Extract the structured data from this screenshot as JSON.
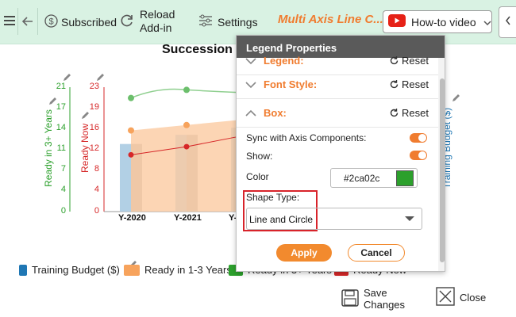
{
  "toolbar": {
    "subscribed_label": "Subscribed",
    "reload_label_1": "Reload",
    "reload_label_2": "Add-in",
    "settings_label": "Settings",
    "app_title": "Multi Axis Line C...",
    "howto_label": "How-to video",
    "icons": [
      "hamburger-icon",
      "back-arrow-icon",
      "dollar-icon",
      "reload-icon",
      "settings-sliders-icon",
      "youtube-icon",
      "chevron-down-icon",
      "chevron-left-icon"
    ]
  },
  "chart": {
    "title": "Succession",
    "left_axis_1_label": "Ready in 3+ Years",
    "left_axis_2_label": "Ready Now",
    "right_axis_label": "Training Budget ($)",
    "left_axis_1_ticks": [
      "21",
      "17",
      "14",
      "11",
      "7",
      "4",
      "0"
    ],
    "left_axis_2_ticks": [
      "23",
      "19",
      "16",
      "12",
      "8",
      "4",
      "0"
    ],
    "x_tick_partial": "Y-",
    "colors": {
      "green": "#2ca02c",
      "red": "#d62728",
      "orange": "#f7a35c",
      "blue": "#1f77b4"
    }
  },
  "chart_data": {
    "type": "bar",
    "title": "Succession",
    "categories": [
      "Y-2020",
      "Y-2021"
    ],
    "series": [
      {
        "name": "Training Budget ($)",
        "type": "bar",
        "values": [
          null,
          null
        ]
      },
      {
        "name": "Ready in 1-3 Years",
        "type": "area",
        "values": [
          15,
          16
        ]
      },
      {
        "name": "Ready in 3+ Years",
        "type": "line",
        "values": [
          21,
          22.5
        ]
      },
      {
        "name": "Ready Now",
        "type": "line",
        "values": [
          10.5,
          12
        ]
      }
    ],
    "ylim": [
      0,
      23
    ]
  },
  "legend": {
    "items": [
      {
        "label": "Training Budget ($)",
        "color": "#1f77b4"
      },
      {
        "label": "Ready in 1-3 Years",
        "color": "#f7a35c"
      },
      {
        "label": "Ready in 3+ Years",
        "color": "#2ca02c"
      },
      {
        "label": "Ready Now",
        "color": "#d62728"
      }
    ]
  },
  "footer": {
    "save_label_1": "Save",
    "save_label_2": "Changes",
    "close_label": "Close"
  },
  "panel": {
    "title": "Legend Properties",
    "sections": [
      {
        "label": "Legend:",
        "reset": "Reset"
      },
      {
        "label": "Font Style:",
        "reset": "Reset"
      },
      {
        "label": "Box:",
        "reset": "Reset"
      }
    ],
    "sync_label": "Sync with Axis Components:",
    "show_label": "Show:",
    "color_label": "Color",
    "color_value": "#2ca02c",
    "shape_type_label": "Shape Type:",
    "shape_type_value": "Line and Circle",
    "apply_label": "Apply",
    "cancel_label": "Cancel"
  }
}
